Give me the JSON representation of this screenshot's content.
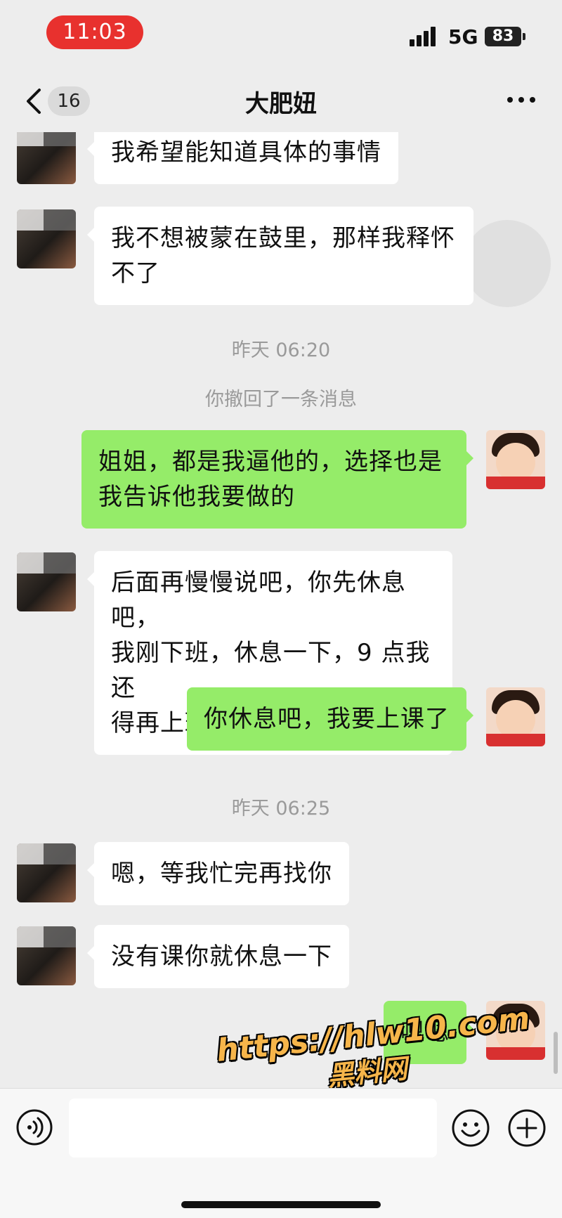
{
  "status_bar": {
    "time": "11:03",
    "network": "5G",
    "battery": "83",
    "time_pill_color": "#e8312e"
  },
  "nav": {
    "back_icon": "chevron-left-icon",
    "unread_count": "16",
    "title": "大肥妞",
    "more_icon": "more-dots-icon"
  },
  "chat": {
    "messages": [
      {
        "side": "left",
        "text": "我希望能知道具体的事情"
      },
      {
        "side": "left",
        "lines": [
          "我不想被蒙在鼓里，那样我释怀",
          "不了"
        ]
      },
      {
        "type": "time",
        "text": "昨天 06:20"
      },
      {
        "type": "system",
        "text": "你撤回了一条消息"
      },
      {
        "side": "right",
        "lines": [
          "姐姐，都是我逼他的，选择也是",
          "我告诉他我要做的"
        ]
      },
      {
        "side": "left",
        "lines": [
          "后面再慢慢说吧，你先休息吧，",
          "我刚下班，休息一下，9 点我还",
          "得再上班"
        ]
      },
      {
        "side": "right",
        "text": "你休息吧，我要上课了"
      },
      {
        "type": "time",
        "text": "昨天 06:25"
      },
      {
        "side": "left",
        "text": "嗯，等我忙完再找你"
      },
      {
        "side": "left",
        "text": "没有课你就休息一下"
      },
      {
        "side": "right",
        "text": "嗯嗯"
      }
    ],
    "left_bubble_color": "#ffffff",
    "right_bubble_color": "#95ec69"
  },
  "watermark": {
    "line1": "https://hlw10.com",
    "line2": "黑料网"
  },
  "input_bar": {
    "voice_icon": "voice-icon",
    "emoji_icon": "emoji-icon",
    "plus_icon": "plus-circle-icon"
  }
}
